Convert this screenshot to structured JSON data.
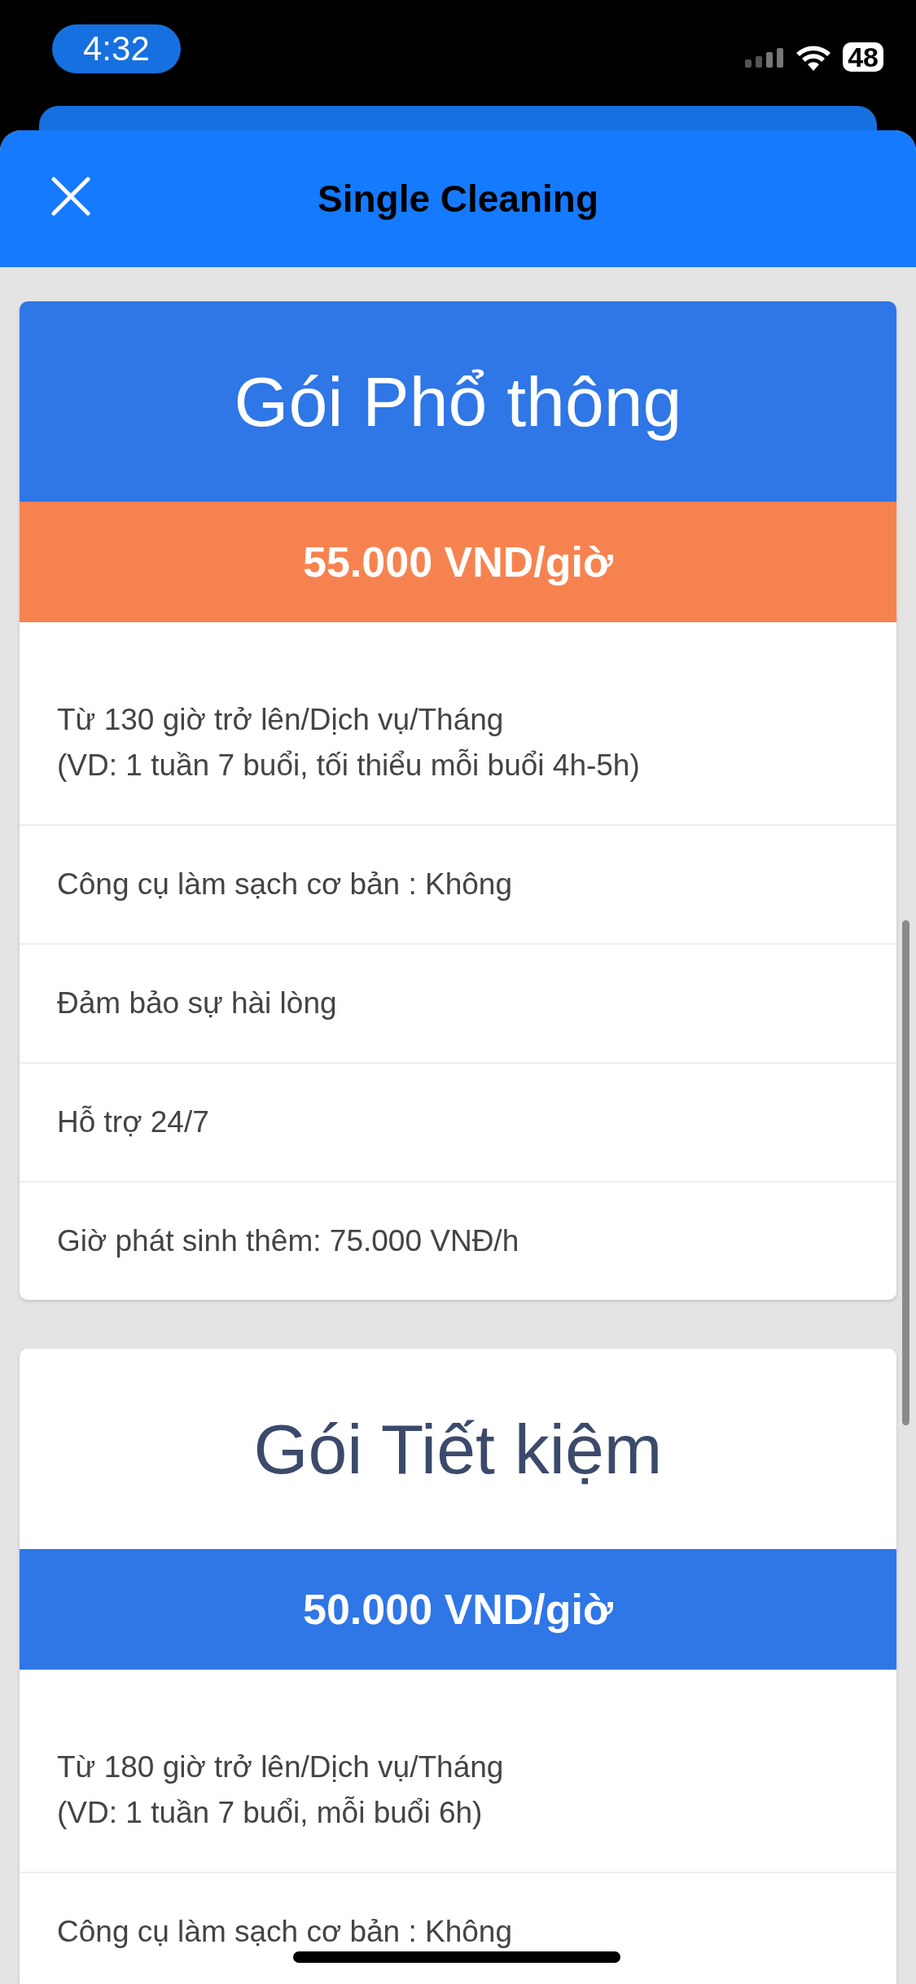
{
  "status_bar": {
    "time": "4:32",
    "battery": "48"
  },
  "header": {
    "title": "Single Cleaning"
  },
  "plans": [
    {
      "title": "Gói Phổ thông",
      "price": "55.000 VND/giờ",
      "highlighted": true,
      "features": [
        "Từ 130 giờ trở lên/Dịch vụ/Tháng\n(VD: 1 tuần 7 buổi, tối thiểu mỗi buổi 4h-5h)",
        "Công cụ làm sạch cơ bản : Không",
        "Đảm bảo sự hài lòng",
        "Hỗ trợ 24/7",
        "Giờ phát sinh thêm: 75.000 VNĐ/h"
      ]
    },
    {
      "title": "Gói Tiết kiệm",
      "price": "50.000 VND/giờ",
      "highlighted": false,
      "features": [
        "Từ 180 giờ trở lên/Dịch vụ/Tháng\n(VD: 1 tuần 7 buổi, mỗi buổi 6h)",
        "Công cụ làm sạch cơ bản : Không"
      ]
    }
  ]
}
